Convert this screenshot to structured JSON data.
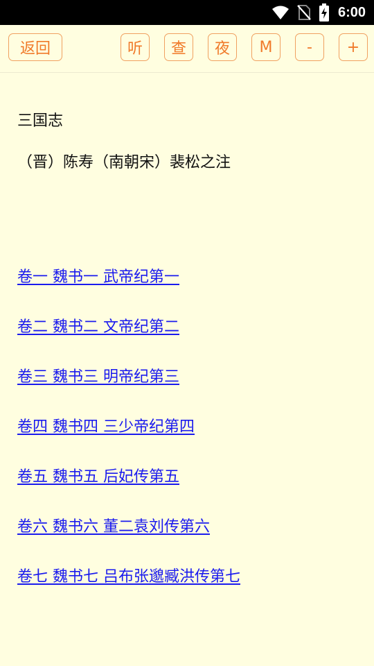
{
  "status_bar": {
    "time": "6:00",
    "icons": [
      "wifi-icon",
      "no-sim-icon",
      "battery-charging-icon"
    ]
  },
  "toolbar": {
    "back_label": "返回",
    "listen_label": "听",
    "search_label": "查",
    "night_label": "夜",
    "menu_label": "M",
    "font_decrease_label": "-",
    "font_increase_label": "+"
  },
  "book": {
    "title": "三国志",
    "authors": "（晋）陈寿（南朝宋）裴松之注"
  },
  "chapters": [
    "卷一 魏书一 武帝纪第一",
    "卷二 魏书二 文帝纪第二",
    "卷三 魏书三 明帝纪第三",
    "卷四 魏书四 三少帝纪第四",
    "卷五 魏书五 后妃传第五",
    "卷六 魏书六 董二袁刘传第六",
    "卷七 魏书七 吕布张邈臧洪传第七"
  ],
  "colors": {
    "background": "#fffee0",
    "accent": "#f07a2a",
    "link": "#1a1aee"
  }
}
